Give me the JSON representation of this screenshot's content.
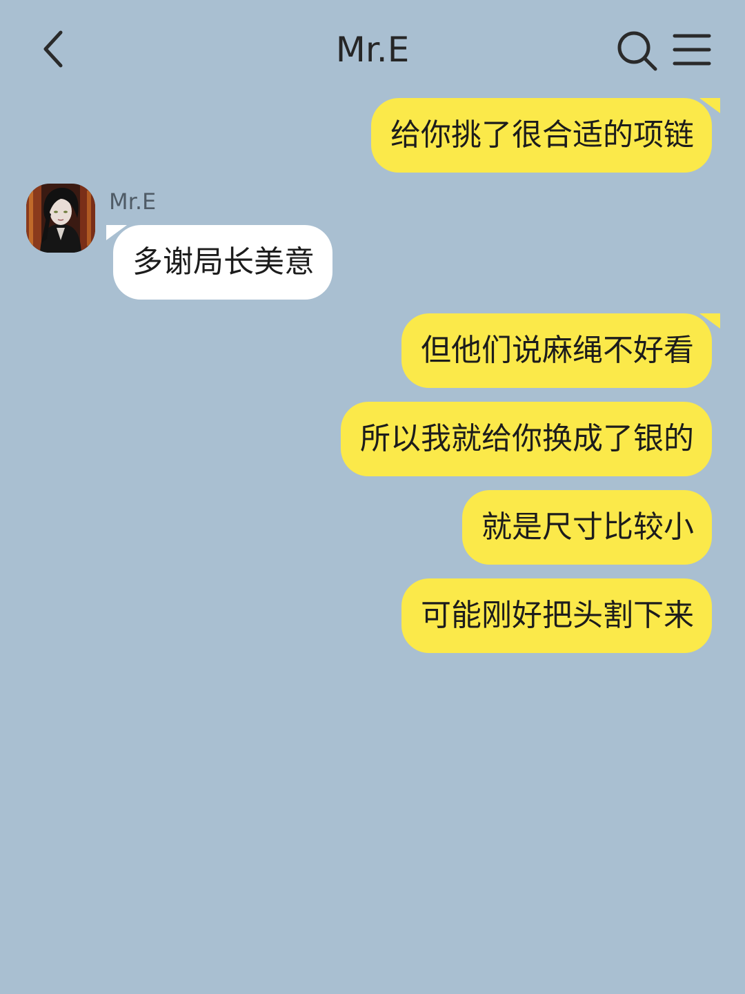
{
  "header": {
    "title": "Mr.E",
    "back_icon": "chevron-left-icon",
    "search_icon": "search-icon",
    "menu_icon": "hamburger-menu-icon"
  },
  "colors": {
    "background": "#a9bfd1",
    "outgoing_bubble": "#fbe94a",
    "incoming_bubble": "#ffffff"
  },
  "messages": [
    {
      "direction": "out",
      "text": "给你挑了很合适的项链"
    },
    {
      "direction": "in",
      "sender": "Mr.E",
      "text": "多谢局长美意"
    },
    {
      "direction": "out",
      "text": "但他们说麻绳不好看"
    },
    {
      "direction": "out",
      "text": "所以我就给你换成了银的"
    },
    {
      "direction": "out",
      "text": "就是尺寸比较小"
    },
    {
      "direction": "out",
      "text": "可能刚好把头割下来"
    }
  ]
}
